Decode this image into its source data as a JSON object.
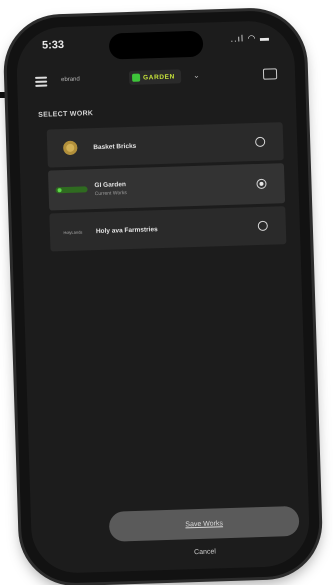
{
  "status_bar": {
    "time": "5:33",
    "indicators": "..ıl ◠ ▬"
  },
  "app_bar": {
    "menu_icon": "hamburger-menu-icon",
    "user_label": "ebrand",
    "brand_name": "GARDEN",
    "chevron": "⌄",
    "message_icon": "message-icon"
  },
  "section_title": "SELECT WORK",
  "works": [
    {
      "title": "Basket Bricks",
      "subtitle": "",
      "logo": "gold-circle-logo",
      "selected": false
    },
    {
      "title": "GI Garden",
      "subtitle": "Current Works",
      "logo": "garden-pill-logo",
      "selected": true
    },
    {
      "title": "Holy ava Farmstries",
      "subtitle": "",
      "logo": "text-logo",
      "selected": false,
      "logo_text": "HolyLands"
    }
  ],
  "actions": {
    "switch_label": "Save Works",
    "cancel_label": "Cancel"
  },
  "colors": {
    "screen_bg": "#1c1c1c",
    "row_bg": "#2a2a2a",
    "brand_accent": "#c6e23a",
    "brand_mark": "#3ec43a",
    "button_bg": "#5a5a5a"
  }
}
